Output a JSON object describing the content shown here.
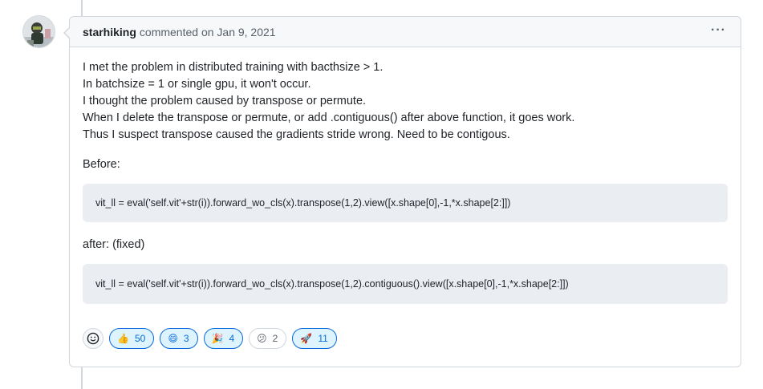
{
  "comment": {
    "author": "starhiking",
    "meta": "commented on Jan 9, 2021",
    "menu_glyph": "···",
    "lines": [
      "I met the problem in distributed training with bacthsize > 1.",
      "In batchsize = 1 or single gpu, it won't occur.",
      "I thought the problem caused by transpose or permute.",
      "When I delete the transpose or permute, or add .contiguous() after above function, it goes work.",
      "Thus I suspect transpose caused the gradients stride wrong. Need to be contigous."
    ],
    "before_label": "Before:",
    "code_before": "vit_ll = eval('self.vit'+str(i)).forward_wo_cls(x).transpose(1,2).view([x.shape[0],-1,*x.shape[2:]])",
    "after_label": "after: (fixed)",
    "code_after": "vit_ll = eval('self.vit'+str(i)).forward_wo_cls(x).transpose(1,2).contiguous().view([x.shape[0],-1,*x.shape[2:]])"
  },
  "reactions": [
    {
      "icon": "thumbs-up-icon",
      "glyph": "👍",
      "count": "50",
      "active": true
    },
    {
      "icon": "laugh-icon",
      "glyph": "😄",
      "count": "3",
      "active": true
    },
    {
      "icon": "hooray-icon",
      "glyph": "🎉",
      "count": "4",
      "active": true
    },
    {
      "icon": "confused-icon",
      "glyph": "😕",
      "count": "2",
      "active": false
    },
    {
      "icon": "rocket-icon",
      "glyph": "🚀",
      "count": "11",
      "active": true
    }
  ],
  "colors": {
    "accent": "#0969da",
    "accent_bg": "#ddf4ff",
    "border": "#d0d7de",
    "header_bg": "#f6f8fa",
    "code_bg": "#eaedf1"
  }
}
